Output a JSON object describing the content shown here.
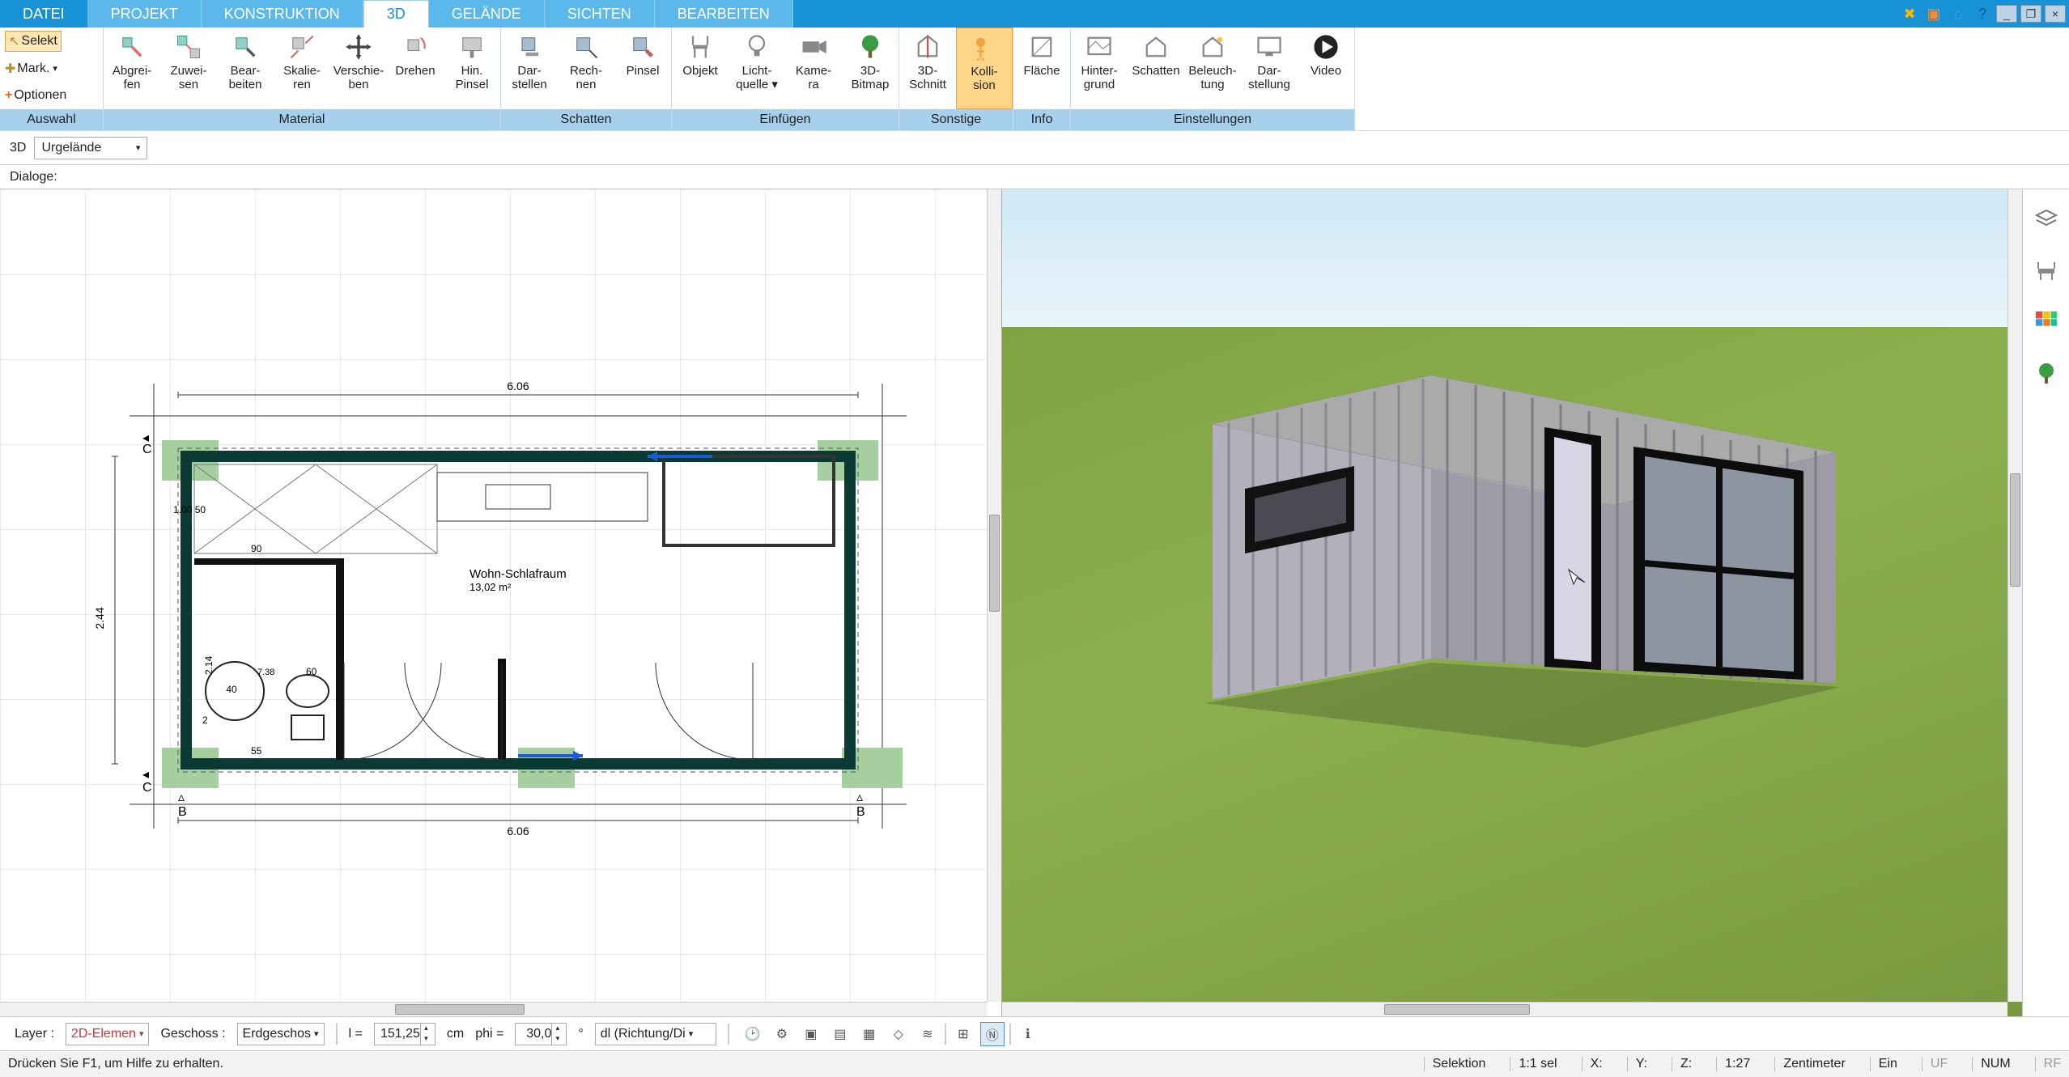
{
  "menu": {
    "tabs": [
      "DATEI",
      "PROJEKT",
      "KONSTRUKTION",
      "3D",
      "GELÄNDE",
      "SICHTEN",
      "BEARBEITEN"
    ],
    "active": 3
  },
  "auswahl": {
    "selekt": "Selekt",
    "mark": "Mark.",
    "optionen": "Optionen",
    "title": "Auswahl"
  },
  "ribbon": {
    "groups": [
      {
        "title": "Material",
        "items": [
          "Abgrei-\nfen",
          "Zuwei-\nsen",
          "Bear-\nbeiten",
          "Skalie-\nren",
          "Verschie-\nben",
          "Drehen",
          "Hin.\nPinsel"
        ]
      },
      {
        "title": "Schatten",
        "items": [
          "Dar-\nstellen",
          "Rech-\nnen",
          "Pinsel"
        ]
      },
      {
        "title": "Einfügen",
        "items": [
          "Objekt",
          "Licht-\nquelle ▾",
          "Kame-\nra",
          "3D-\nBitmap"
        ]
      },
      {
        "title": "Sonstige",
        "items": [
          "3D-\nSchnitt",
          "Kolli-\nsion"
        ],
        "active": 1
      },
      {
        "title": "Info",
        "items": [
          "Fläche"
        ]
      },
      {
        "title": "Einstellungen",
        "items": [
          "Hinter-\ngrund",
          "Schatten",
          "Beleuch-\ntung",
          "Dar-\nstellung",
          "Video"
        ]
      }
    ]
  },
  "subbar": {
    "mode": "3D",
    "layer": "Urgelände"
  },
  "dlgbar": {
    "label": "Dialoge:"
  },
  "plan": {
    "width_label_top": "6.06",
    "width_label_bottom": "6.06",
    "height_label": "2.44",
    "room_name": "Wohn-Schlafraum",
    "room_area": "13,02 m²",
    "sec_c": "C",
    "sec_b": "B",
    "dims": {
      "d100_50": "1.00\n50",
      "d90": "90",
      "d738": "7.38",
      "d60": "60",
      "d40": "40",
      "d2b": "2",
      "d55": "55",
      "d214": "2.14"
    }
  },
  "bottom": {
    "layer_label": "Layer :",
    "layer_value": "2D-Elemen",
    "geschoss_label": "Geschoss :",
    "geschoss_value": "Erdgeschos",
    "l_label": "l =",
    "l_value": "151,25",
    "cm": "cm",
    "phi_label": "phi =",
    "phi_value": "30,0",
    "deg": "°",
    "dl_label": "dl (Richtung/Di"
  },
  "status": {
    "help": "Drücken Sie F1, um Hilfe zu erhalten.",
    "sel": "Selektion",
    "ratio1": "1:1 sel",
    "x": "X:",
    "y": "Y:",
    "z": "Z:",
    "ratio2": "1:27",
    "unit": "Zentimeter",
    "ein": "Ein",
    "uf": "UF",
    "num": "NUM",
    "rf": "RF"
  },
  "palette": {
    "items": [
      "layers",
      "chair",
      "swatches",
      "tree"
    ]
  }
}
